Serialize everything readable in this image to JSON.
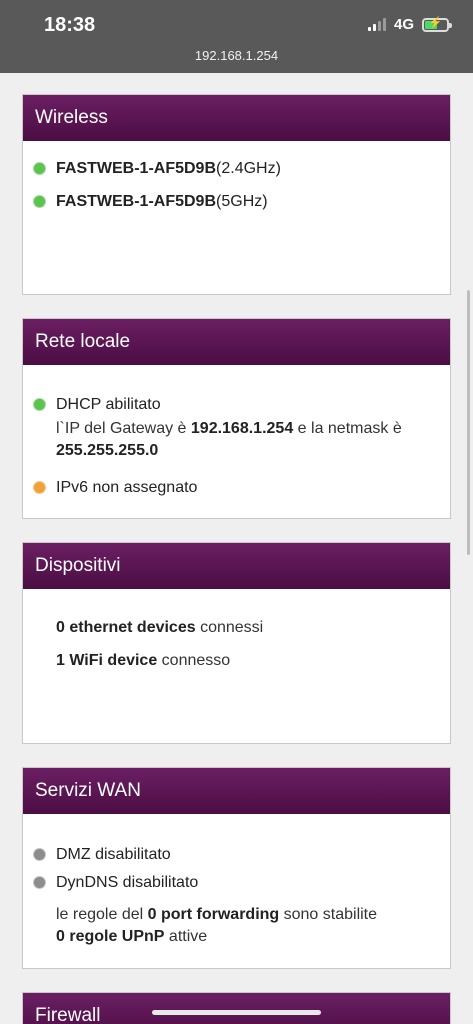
{
  "status": {
    "time": "18:38",
    "network": "4G",
    "url": "192.168.1.254",
    "battery_level": 0.55,
    "battery_color": "#4cd964"
  },
  "wireless": {
    "title": "Wireless",
    "items": [
      {
        "name": "FASTWEB-1-AF5D9B",
        "band": "(2.4GHz)",
        "status": "green"
      },
      {
        "name": "FASTWEB-1-AF5D9B",
        "band": "(5GHz)",
        "status": "green"
      }
    ]
  },
  "lan": {
    "title": "Rete locale",
    "dhcp": "DHCP abilitato",
    "gw_prefix": "l`IP del Gateway è ",
    "gw_ip": "192.168.1.254",
    "gw_middle": " e la netmask è ",
    "netmask": "255.255.255.0",
    "ipv6": "IPv6 non assegnato"
  },
  "devices": {
    "title": "Dispositivi",
    "ethernet_bold": "0 ethernet devices",
    "ethernet_rest": " connessi",
    "wifi_bold": "1 WiFi device",
    "wifi_rest": " connesso"
  },
  "wan": {
    "title": "Servizi WAN",
    "dmz": "DMZ disabilitato",
    "dyndns": "DynDNS disabilitato",
    "pf_prefix": "le regole del ",
    "pf_bold": "0 port forwarding",
    "pf_suffix": " sono stabilite",
    "upnp_bold": "0 regole UPnP",
    "upnp_suffix": " attive"
  },
  "firewall": {
    "title": "Firewall"
  }
}
